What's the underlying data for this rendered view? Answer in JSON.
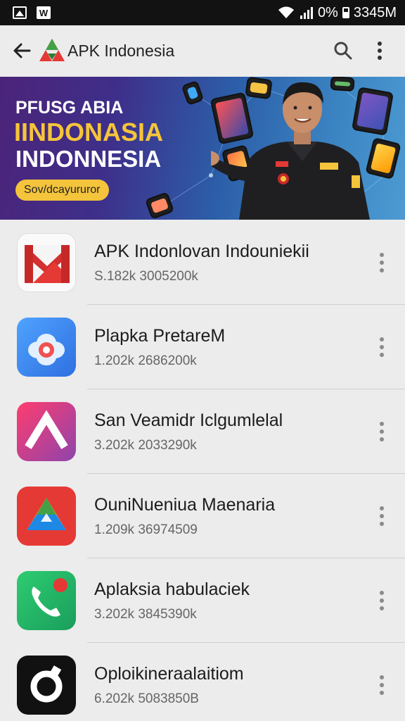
{
  "status_bar": {
    "battery_text": "0%",
    "time": "3345M"
  },
  "app_bar": {
    "title": "APK Indonesia"
  },
  "banner": {
    "line1": "PFUSG ABIA",
    "line2": "IINDONASIA",
    "line3": "INDONNESIA",
    "button_label": "Sov/dcayururor"
  },
  "apps": [
    {
      "name": "APK Indonlovan Indouniekii",
      "meta": "S.182k  3005200k",
      "icon": "gmail-like-icon"
    },
    {
      "name": "Plapka PretareM",
      "meta": "1.202k  2686200k",
      "icon": "flower-cloud-icon"
    },
    {
      "name": "San Veamidr Iclgumlelal",
      "meta": "3.202k  2033290k",
      "icon": "caret-up-icon"
    },
    {
      "name": "OuniNueniua Maenaria",
      "meta": "1.209k  36974509",
      "icon": "drive-triangle-icon"
    },
    {
      "name": "Aplaksia habulaciek",
      "meta": "3.202k  3845390k",
      "icon": "phone-call-icon"
    },
    {
      "name": "Oploikineraalaitiom",
      "meta": "6.202k  5083850B",
      "icon": "ring-logo-icon"
    }
  ],
  "colors": {
    "accent_yellow": "#f3c43c",
    "banner_purple": "#4b2479",
    "banner_blue": "#3b84c2"
  }
}
